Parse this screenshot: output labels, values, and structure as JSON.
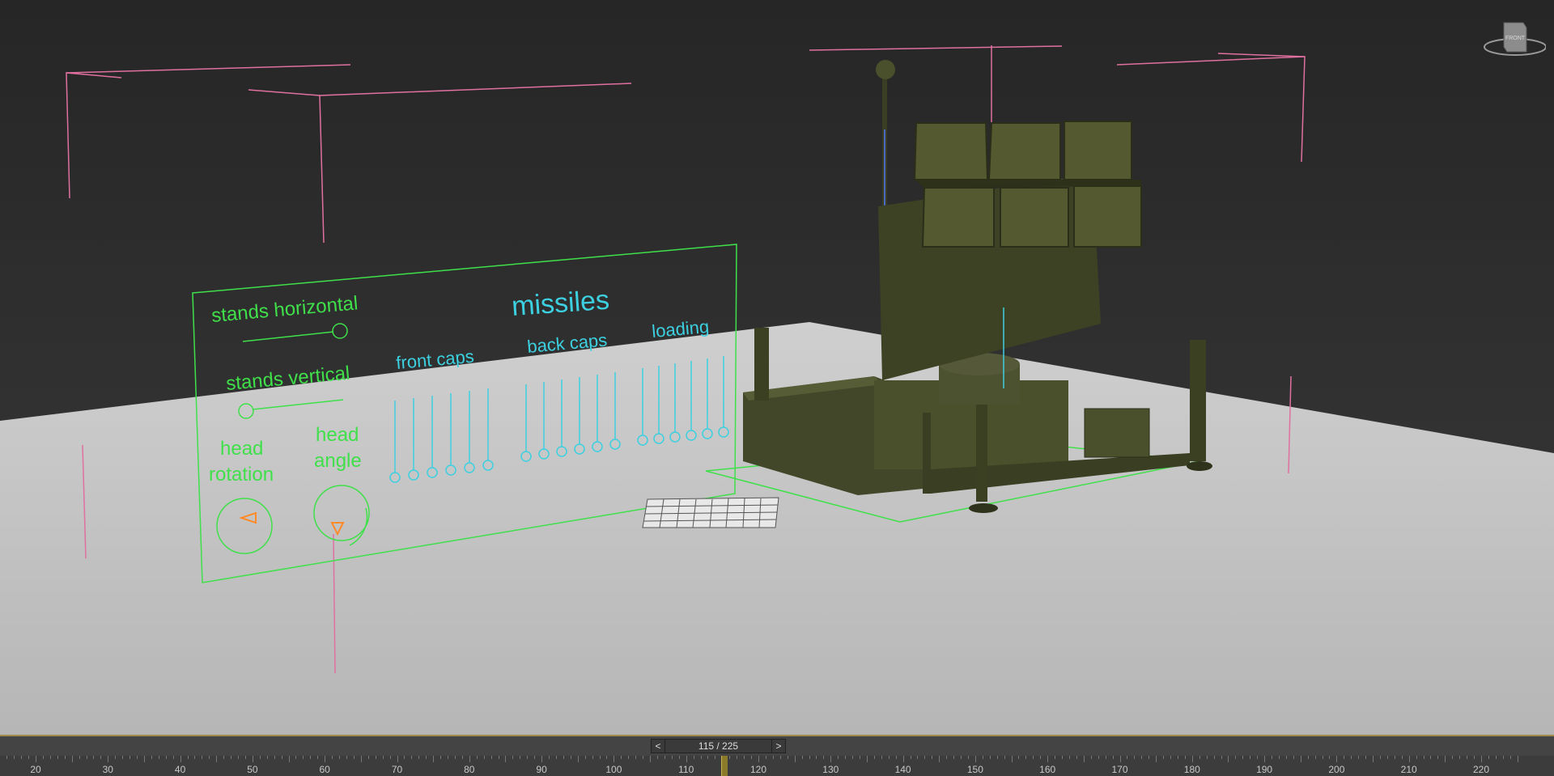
{
  "viewport": {
    "controls_panel": {
      "stands_horizontal": "stands horizontal",
      "stands_vertical": "stands vertical",
      "head_rotation": [
        "head",
        "rotation"
      ],
      "head_angle": [
        "head",
        "angle"
      ],
      "missiles": "missiles",
      "front_caps": "front caps",
      "back_caps": "back caps",
      "loading": "loading"
    },
    "viewcube_label": "FRONT"
  },
  "timeline": {
    "prev_label": "<",
    "next_label": ">",
    "frame_display": "115 / 225",
    "current_frame": 115,
    "total_frames": 225,
    "ruler_labels": [
      "20",
      "30",
      "40",
      "50",
      "60",
      "70",
      "80",
      "90",
      "100",
      "110",
      "120",
      "130",
      "140",
      "150",
      "160",
      "170",
      "180",
      "190",
      "200",
      "210",
      "220"
    ]
  },
  "colors": {
    "background": "#2d2d2d",
    "ground": "#b8b8b8",
    "control_green": "#3fe04a",
    "control_cyan": "#3cd0e0",
    "helper_pink": "#e070a0",
    "vehicle_olive": "#4a4f2c"
  }
}
